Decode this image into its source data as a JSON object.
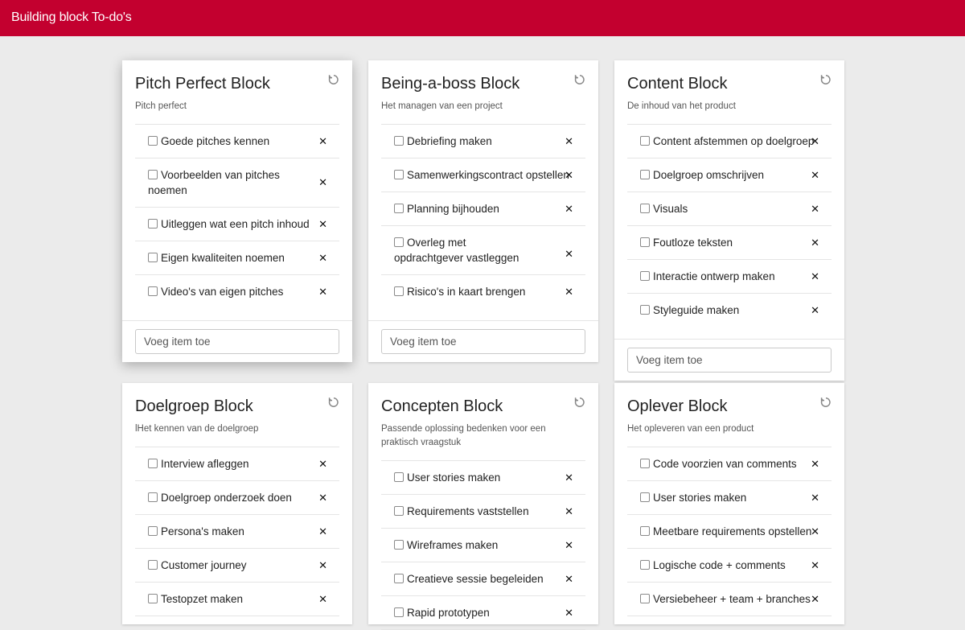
{
  "app": {
    "title": "Building block To-do's"
  },
  "add_placeholder": "Voeg item toe",
  "cards": [
    {
      "title": "Pitch Perfect Block",
      "description": "Pitch perfect",
      "items": [
        "Goede pitches kennen",
        "Voorbeelden van pitches noemen",
        "Uitleggen wat een pitch inhoud",
        "Eigen kwaliteiten noemen",
        "Video's van eigen pitches"
      ]
    },
    {
      "title": "Being-a-boss Block",
      "description": "Het managen van een project",
      "items": [
        "Debriefing maken",
        "Samenwerkingscontract opstellen",
        "Planning bijhouden",
        "Overleg met opdrachtgever vastleggen",
        "Risico's in kaart brengen"
      ]
    },
    {
      "title": "Content Block",
      "description": "De inhoud van het product",
      "items": [
        "Content afstemmen op doelgroep",
        "Doelgroep omschrijven",
        "Visuals",
        "Foutloze teksten",
        "Interactie ontwerp maken",
        "Styleguide maken"
      ]
    },
    {
      "title": "Doelgroep Block",
      "description": "lHet kennen van de doelgroep",
      "items": [
        "Interview afleggen",
        "Doelgroep onderzoek doen",
        "Persona's maken",
        "Customer journey",
        "Testopzet maken"
      ]
    },
    {
      "title": "Concepten Block",
      "description": "Passende oplossing bedenken voor een praktisch vraagstuk",
      "items": [
        "User stories maken",
        "Requirements vaststellen",
        "Wireframes maken",
        "Creatieve sessie begeleiden",
        "Rapid prototypen"
      ]
    },
    {
      "title": "Oplever Block",
      "description": "Het opleveren van een product",
      "items": [
        "Code voorzien van comments",
        "User stories maken",
        "Meetbare requirements opstellen",
        "Logische code + comments",
        "Versiebeheer + team + branches"
      ]
    }
  ],
  "colors": {
    "header": "#c3002f",
    "background": "#ebebeb"
  },
  "icons": {
    "reset": "reset-icon",
    "delete": "close-icon"
  }
}
